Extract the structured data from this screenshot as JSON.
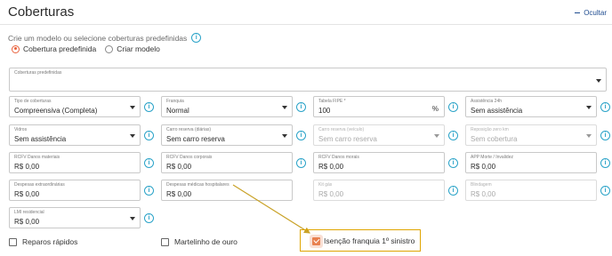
{
  "header": {
    "title": "Coberturas",
    "hide_label": "Ocultar"
  },
  "helper_text": "Crie um modelo ou selecione coberturas predefinidas",
  "mode": {
    "options": [
      "Cobertura predefinida",
      "Criar modelo"
    ],
    "selected": "Cobertura predefinida"
  },
  "predef": {
    "label": "Coberturas predefinidas",
    "value": ""
  },
  "fields": {
    "tipo": {
      "label": "Tipo de coberturas",
      "value": "Compreensiva (Completa)"
    },
    "franquia": {
      "label": "Franquia",
      "value": "Normal"
    },
    "fipe": {
      "label": "Tabela FIPE *",
      "value": "100",
      "suffix": "%"
    },
    "assist": {
      "label": "Assistência 24h",
      "value": "Sem assistência"
    },
    "vidros": {
      "label": "Vidros",
      "value": "Sem assistência"
    },
    "carro": {
      "label": "Carro reserva (diárias)",
      "value": "Sem carro reserva"
    },
    "carro_veic": {
      "label": "Carro reserva (veículo)",
      "value": "Sem carro reserva"
    },
    "reparo": {
      "label": "Reposição zero km",
      "value": "Sem cobertura"
    },
    "rcfv_mat": {
      "label": "RCFV Danos materiais",
      "value": "R$ 0,00"
    },
    "rcfv_corp": {
      "label": "RCFV Danos corporais",
      "value": "R$ 0,00"
    },
    "rcfv_mor": {
      "label": "RCFV Danos morais",
      "value": "R$ 0,00"
    },
    "app": {
      "label": "APP Morte / Invalidez",
      "value": "R$ 0,00"
    },
    "desp_ext": {
      "label": "Despesas extraordinárias",
      "value": "R$ 0,00"
    },
    "desp_med": {
      "label": "Despesas médicas hospitalares",
      "value": "R$ 0,00"
    },
    "kit_gas": {
      "label": "Kit gás",
      "value": "R$ 0,00"
    },
    "blind": {
      "label": "Blindagem",
      "value": "R$ 0,00"
    },
    "lmi": {
      "label": "LMI residencial",
      "value": "R$ 0,00"
    }
  },
  "checks": {
    "reparos": {
      "label": "Reparos rápidos",
      "checked": false
    },
    "martelinho": {
      "label": "Martelinho de ouro",
      "checked": false
    },
    "isencao": {
      "label": "Isenção franquia 1º sinistro",
      "checked": true
    }
  },
  "colors": {
    "accent": "#e8603a",
    "info": "#2aa3c8",
    "highlight": "#e0a500",
    "link": "#1e4b8f"
  }
}
